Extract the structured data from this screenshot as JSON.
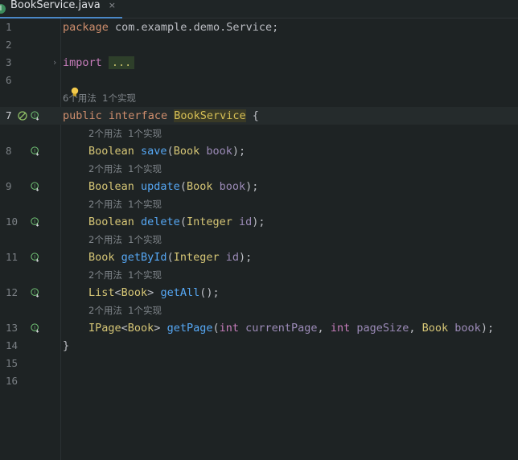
{
  "tab": {
    "icon": "interface-icon",
    "label": "BookService.java",
    "close": "×"
  },
  "hint_usages": "2个用法  1个实现",
  "hint_top": "6个用法  1个实现",
  "lines": {
    "l1": {
      "num": "1",
      "t1": "package",
      "t2": " com.example.demo.Service;"
    },
    "l2": {
      "num": "2"
    },
    "l3": {
      "num": "3",
      "t1": "import",
      "t2": " ",
      "t3": "..."
    },
    "l6": {
      "num": "6"
    },
    "l7": {
      "num": "7",
      "t1": "public",
      "t2": " ",
      "t3": "interface",
      "t4": " ",
      "t5": "BookService",
      "t6": " {"
    },
    "l8": {
      "num": "8",
      "t1": "Boolean",
      "t2": " ",
      "t3": "save",
      "t4": "(",
      "t5": "Book",
      "t6": " ",
      "t7": "book",
      "t8": ");"
    },
    "l9": {
      "num": "9",
      "t1": "Boolean",
      "t2": " ",
      "t3": "update",
      "t4": "(",
      "t5": "Book",
      "t6": " ",
      "t7": "book",
      "t8": ");"
    },
    "l10": {
      "num": "10",
      "t1": "Boolean",
      "t2": " ",
      "t3": "delete",
      "t4": "(",
      "t5": "Integer",
      "t6": " ",
      "t7": "id",
      "t8": ");"
    },
    "l11": {
      "num": "11",
      "t1": "Book",
      "t2": " ",
      "t3": "getById",
      "t4": "(",
      "t5": "Integer",
      "t6": " ",
      "t7": "id",
      "t8": ");"
    },
    "l12": {
      "num": "12",
      "t1": "List",
      "t2": "<",
      "t3": "Book",
      "t4": "> ",
      "t5": "getAll",
      "t6": "();"
    },
    "l13": {
      "num": "13",
      "t1": "IPage",
      "t2": "<",
      "t3": "Book",
      "t4": "> ",
      "t5": "getPage",
      "t6": "(",
      "t7": "int",
      "t8": " ",
      "t9": "currentPage",
      "t10": ", ",
      "t11": "int",
      "t12": " ",
      "t13": "pageSize",
      "t14": ", ",
      "t15": "Book",
      "t16": " ",
      "t17": "book",
      "t18": ");"
    },
    "l14": {
      "num": "14",
      "t1": "}"
    },
    "l15": {
      "num": "15"
    },
    "l16": {
      "num": "16"
    }
  }
}
